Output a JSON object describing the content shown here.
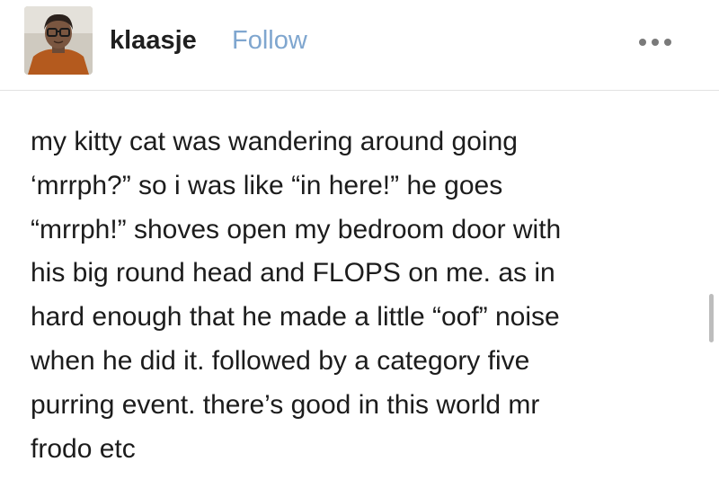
{
  "header": {
    "username": "klaasje",
    "follow_label": "Follow",
    "more_icon": "more-horizontal-icon"
  },
  "post": {
    "lines": [
      "my kitty cat was wandering around going",
      "‘mrrph?” so i was like “in here!” he goes",
      "“mrrph!” shoves open my bedroom door with",
      "his big round head and FLOPS on me. as in",
      "hard enough that he made a little “oof” noise",
      "when he did it. followed by a category five",
      "purring event. there’s good in this world mr",
      "frodo etc"
    ]
  },
  "colors": {
    "follow": "#7fa6cf",
    "text": "#1c1c1c",
    "divider": "#e2e2e2"
  }
}
